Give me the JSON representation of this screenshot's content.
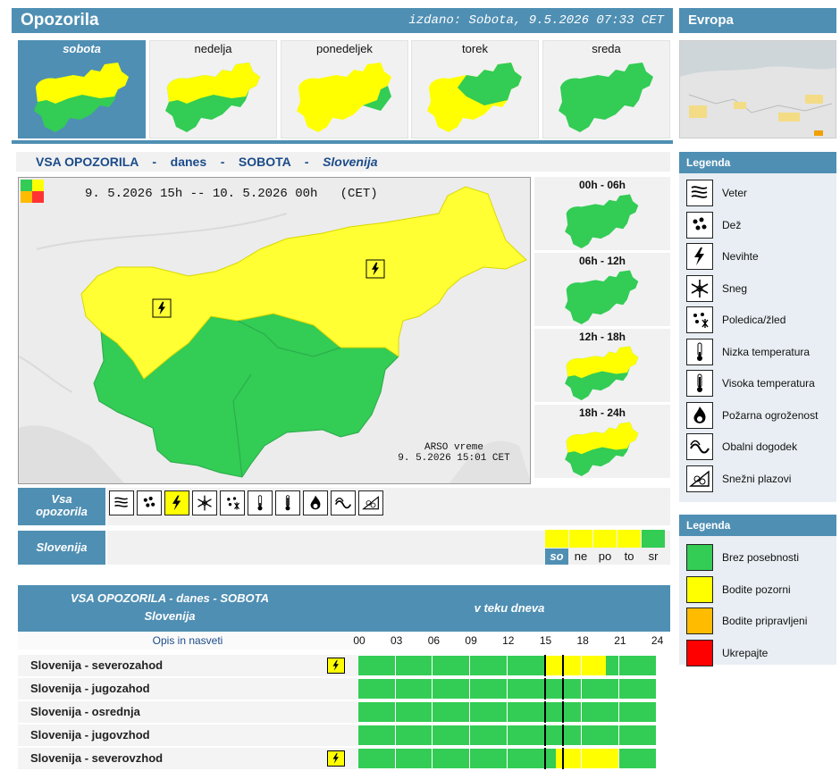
{
  "header": {
    "title": "Opozorila",
    "issued": "izdano: Sobota, 9.5.2026 07:33 CET",
    "europe_title": "Evropa"
  },
  "days": [
    {
      "label": "sobota",
      "selected": true
    },
    {
      "label": "nedelja",
      "selected": false
    },
    {
      "label": "ponedeljek",
      "selected": false
    },
    {
      "label": "torek",
      "selected": false
    },
    {
      "label": "sreda",
      "selected": false
    }
  ],
  "main_title": {
    "part1": "VSA OPOZORILA",
    "sep": "-",
    "part2": "danes",
    "part3": "SOBOTA",
    "region": "Slovenija"
  },
  "map": {
    "valid": "9. 5.2026 15h -- 10. 5.2026 00h   (CET)",
    "credit_line1": "ARSO vreme",
    "credit_line2": "9. 5.2026  15:01 CET"
  },
  "periods": [
    "00h - 06h",
    "06h - 12h",
    "12h - 18h",
    "18h - 24h"
  ],
  "warning_panel": {
    "vsa_line1": "Vsa",
    "vsa_line2": "opozorila",
    "region_label": "Slovenija",
    "icons": [
      "wind-icon",
      "rain-icon",
      "thunderstorm-icon",
      "snow-icon",
      "ice-icon",
      "low-temp-icon",
      "high-temp-icon",
      "fire-icon",
      "coastal-icon",
      "avalanche-icon"
    ],
    "active_icon": "thunderstorm-icon",
    "forecast_days": [
      "so",
      "ne",
      "po",
      "to",
      "sr"
    ],
    "forecast_levels": [
      "yellow",
      "yellow",
      "yellow",
      "yellow",
      "green"
    ]
  },
  "legend_events": {
    "title": "Legenda",
    "items": [
      {
        "icon": "wind-icon",
        "label": "Veter"
      },
      {
        "icon": "rain-icon",
        "label": "Dež"
      },
      {
        "icon": "thunderstorm-icon",
        "label": "Nevihte"
      },
      {
        "icon": "snow-icon",
        "label": "Sneg"
      },
      {
        "icon": "ice-icon",
        "label": "Poledica/žled"
      },
      {
        "icon": "low-temp-icon",
        "label": "Nizka temperatura"
      },
      {
        "icon": "high-temp-icon",
        "label": "Visoka temperatura"
      },
      {
        "icon": "fire-icon",
        "label": "Požarna ogroženost"
      },
      {
        "icon": "coastal-icon",
        "label": "Obalni dogodek"
      },
      {
        "icon": "avalanche-icon",
        "label": "Snežni plazovi"
      }
    ]
  },
  "legend_levels": {
    "title": "Legenda",
    "items": [
      {
        "color": "#33cc55",
        "label": "Brez posebnosti"
      },
      {
        "color": "#ffff00",
        "label": "Bodite pozorni"
      },
      {
        "color": "#ffbb00",
        "label": "Bodite pripravljeni"
      },
      {
        "color": "#ff0000",
        "label": "Ukrepajte"
      }
    ]
  },
  "table": {
    "title_line1": "VSA OPOZORILA - danes - SOBOTA",
    "title_line2": "Slovenija",
    "during_day": "v teku dneva",
    "desc_header": "Opis in nasveti",
    "hours": [
      "00",
      "03",
      "06",
      "09",
      "12",
      "15",
      "18",
      "21",
      "24"
    ],
    "rows": [
      {
        "region": "Slovenija - severozahod",
        "icon": "thunderstorm-icon",
        "yellow_from_h": 15.5,
        "yellow_to_h": 20.5
      },
      {
        "region": "Slovenija - jugozahod",
        "icon": "",
        "yellow_from_h": null,
        "yellow_to_h": null
      },
      {
        "region": "Slovenija - osrednja",
        "icon": "",
        "yellow_from_h": null,
        "yellow_to_h": null
      },
      {
        "region": "Slovenija - jugovzhod",
        "icon": "",
        "yellow_from_h": null,
        "yellow_to_h": null
      },
      {
        "region": "Slovenija - severovzhod",
        "icon": "thunderstorm-icon",
        "yellow_from_h": 16.5,
        "yellow_to_h": 21.5
      }
    ],
    "markers_h": [
      15,
      16.5
    ]
  },
  "colors": {
    "green": "#33cc55",
    "yellow": "#ffff00",
    "header_blue": "#4f8fb3"
  }
}
